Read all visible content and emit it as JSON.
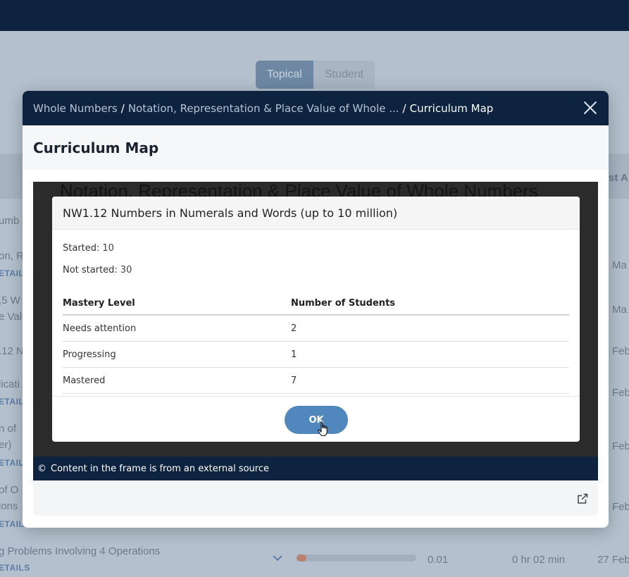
{
  "background": {
    "toggle": {
      "topical": "Topical",
      "student": "Student"
    },
    "column_fragments": {
      "left_header": "umb",
      "right_header": "st A"
    },
    "rows": [
      {
        "title": "on, R",
        "link": "ETAIL",
        "date": "Ma"
      },
      {
        "title": ",5 W",
        "title2": "e Val",
        "date": "Ma"
      },
      {
        "title": ".12 N",
        "date": "Feb"
      },
      {
        "title": "licati",
        "link": "ETAIL",
        "date": "Feb"
      },
      {
        "title": "n of",
        "title2": "er)",
        "link": "ETAIL",
        "date": "Feb"
      },
      {
        "title": "of O",
        "title2": "ions",
        "link": "ETAIL",
        "date": "Feb"
      },
      {
        "title": "g Problems Involving 4 Operations",
        "link": "ETAILS",
        "score": "0.01",
        "time": "0 hr 02 min",
        "date": "27 Feb",
        "progress": 0.08
      }
    ]
  },
  "modal": {
    "breadcrumb": [
      "Whole Numbers",
      "Notation, Representation & Place Value of Whole ...",
      "Curriculum Map"
    ],
    "breadcrumb_separator": "/",
    "title": "Curriculum Map",
    "frame": {
      "background_title": "Notation, Representation & Place Value of Whole Numbers",
      "dialog": {
        "title": "NW1.12 Numbers in Numerals and Words (up to 10 million)",
        "started_label": "Started:",
        "started_value": "10",
        "not_started_label": "Not started:",
        "not_started_value": "30",
        "table": {
          "headers": [
            "Mastery Level",
            "Number of Students"
          ],
          "rows": [
            [
              "Needs attention",
              "2"
            ],
            [
              "Progressing",
              "1"
            ],
            [
              "Mastered",
              "7"
            ]
          ]
        },
        "ok_label": "OK"
      }
    },
    "footer_note": "Content in the frame is from an external source",
    "footer_copyright": "©"
  },
  "colors": {
    "navy": "#0e2340",
    "ok_button": "#5088bd",
    "overlay": "#b4c0cd"
  },
  "icons": [
    "close-icon",
    "external-link-icon",
    "chevron-down-icon",
    "hand-cursor-icon"
  ]
}
